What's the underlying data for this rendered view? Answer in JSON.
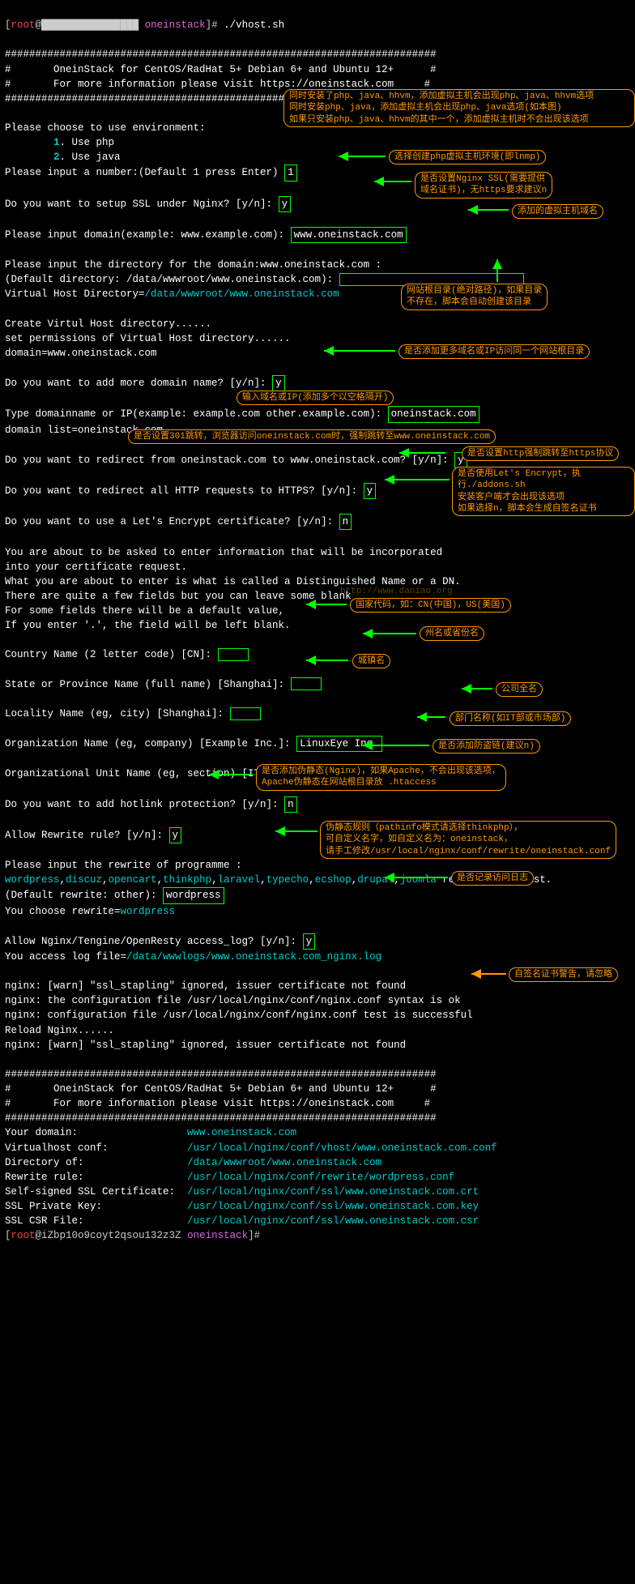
{
  "prompt1": {
    "user": "root",
    "host": "@",
    "hostblur": "████████████████",
    "dir": "oneinstack",
    "cmd": "./vhost.sh"
  },
  "banner": {
    "bar": "#######################################################################",
    "l1": "#       OneinStack for CentOS/RadHat 5+ Debian 6+ and Ubuntu 12+      #",
    "l2": "#       For more information please visit https://oneinstack.com     #"
  },
  "env": {
    "title": "Please choose to use environment:",
    "o1": "1",
    "o1t": ". Use php",
    "o2": "2",
    "o2t": ". Use java",
    "numq": "Please input a number:(Default 1 press Enter) ",
    "numv": "1"
  },
  "ssl": {
    "q": "Do you want to setup SSL under Nginx? [y/n]: ",
    "v": "y"
  },
  "domain": {
    "q": "Please input domain(example: www.example.com): ",
    "v": "www.oneinstack.com"
  },
  "dir": {
    "l1": "Please input the directory for the domain:www.oneinstack.com :",
    "l2": "(Default directory: /data/wwwroot/www.oneinstack.com): ",
    "l3a": "Virtual Host Directory=",
    "l3b": "/data/wwwroot/www.oneinstack.com"
  },
  "create": {
    "l1": "Create Virtul Host directory......",
    "l2": "set permissions of Virtual Host directory......",
    "l3": "domain=www.oneinstack.com"
  },
  "more": {
    "q": "Do you want to add more domain name? [y/n]: ",
    "v": "y"
  },
  "type": {
    "q": "Type domainname or IP(example: example.com other.example.com): ",
    "v": "oneinstack.com",
    "list": "domain list=oneinstack.com"
  },
  "redir1": {
    "q": "Do you want to redirect from oneinstack.com to www.oneinstack.com? [y/n]: ",
    "v": "y"
  },
  "redir2": {
    "q": "Do you want to redirect all HTTP requests to HTTPS? [y/n]: ",
    "v": "y"
  },
  "le": {
    "q": "Do you want to use a Let's Encrypt certificate? [y/n]: ",
    "v": "n"
  },
  "cert": {
    "l1": "You are about to be asked to enter information that will be incorporated",
    "l2": "into your certificate request.",
    "l3": "What you are about to enter is what is called a Distinguished Name or a DN.",
    "l4": "There are quite a few fields but you can leave some blank",
    "l5": "For some fields there will be a default value,",
    "l6": "If you enter '.', the field will be left blank."
  },
  "wm": "http://www.daniao.org",
  "csr": {
    "cn": "Country Name (2 letter code) [CN]: ",
    "sp": "State or Province Name (full name) [Shanghai]: ",
    "lc": "Locality Name (eg, city) [Shanghai]: ",
    "org": "Organization Name (eg, company) [Example Inc.]: ",
    "orgv": "LinuxEye Inc.",
    "ou": "Organizational Unit Name (eg, section) [IT Dept.]: "
  },
  "hot": {
    "q": "Do you want to add hotlink protection? [y/n]: ",
    "v": "n"
  },
  "rw": {
    "q": "Allow Rewrite rule? [y/n]: ",
    "v": "y"
  },
  "rwp": {
    "l1": "Please input the rewrite of programme :",
    "l2a": "wordpress",
    "l2b": ",",
    "l2c": "discuz",
    "l2d": "opencart",
    "l2e": "thinkphp",
    "l2f": "laravel",
    "l2g": "typecho",
    "l2h": "ecshop",
    "l2i": "drupal",
    "l2j": "joomla",
    "l2k": " rewrite was exist.",
    "l3": "(Default rewrite: other): ",
    "l3v": "wordpress",
    "l4": "You choose rewrite=",
    "l4v": "wordpress"
  },
  "log": {
    "q": "Allow Nginx/Tengine/OpenResty access_log? [y/n]: ",
    "v": "y",
    "l2": "You access log file=",
    "l2v": "/data/wwwlogs/www.oneinstack.com_nginx.log"
  },
  "ng": {
    "l1": "nginx: [warn] \"ssl_stapling\" ignored, issuer certificate not found",
    "l2": "nginx: the configuration file /usr/local/nginx/conf/nginx.conf syntax is ok",
    "l3": "nginx: configuration file /usr/local/nginx/conf/nginx.conf test is successful",
    "l4": "Reload Nginx......",
    "l5": "nginx: [warn] \"ssl_stapling\" ignored, issuer certificate not found"
  },
  "out": {
    "k1": "Your domain:",
    "v1": "www.oneinstack.com",
    "k2": "Virtualhost conf:",
    "v2": "/usr/local/nginx/conf/vhost/www.oneinstack.com.conf",
    "k3": "Directory of:",
    "v3": "/data/wwwroot/www.oneinstack.com",
    "k4": "Rewrite rule:",
    "v4": "/usr/local/nginx/conf/rewrite/wordpress.conf",
    "k5": "Self-signed SSL Certificate:",
    "v5": "/usr/local/nginx/conf/ssl/www.oneinstack.com.crt",
    "k6": "SSL Private Key:",
    "v6": "/usr/local/nginx/conf/ssl/www.oneinstack.com.key",
    "k7": "SSL CSR File:",
    "v7": "/usr/local/nginx/conf/ssl/www.oneinstack.com.csr"
  },
  "prompt2": {
    "user": "root",
    "host": "@iZbp10o9coyt2qsou132z3Z",
    "dir": "oneinstack"
  },
  "a": {
    "env": "同时安装了php、java、hhvm，添加虚拟主机会出现php、java、hhvm选项\n同时安装php、java，添加虚拟主机会出现php、java选项(如本图)\n如果只安装php、java、hhvm的其中一个，添加虚拟主机时不会出现该选项",
    "num": "选择创建php虚拟主机环境(即lnmp)",
    "ssl": "是否设置Nginx SSL(需要提供\n域名证书)，无https要求建议n",
    "domain": "添加的虚拟主机域名",
    "dir": "网站根目录(绝对路径)，如果目录\n不存在，脚本会自动创建该目录",
    "more": "是否添加更多域名或IP访问同一个网站根目录",
    "type": "输入域名或IP(添加多个以空格隔开)",
    "r301": "是否设置301跳转，浏览器访问oneinstack.com时，强制跳转至www.oneinstack.com",
    "https": "是否设置http强制跳转至https协议",
    "le": "是否使用Let's Encrypt，执行./addons.sh\n安装客户端才会出现该选项\n如果选择n，脚本会生成自签名证书",
    "cn": "国家代码，如：CN(中国)，US(美国)",
    "sp": "州名或省份名",
    "lc": "城镇名",
    "org": "公司全名",
    "ou": "部门名称(如IT部或市场部)",
    "hot": "是否添加防盗链(建议n)",
    "rw": "是否添加伪静态(Nginx)，如果Apache，不会出现该选项，\nApache伪静态在网站根目录放 .htaccess",
    "rwp": "伪静态规则（pathinfo模式请选择thinkphp），\n可自定义名字，如自定义名为：oneinstack，\n请手工修改/usr/local/nginx/conf/rewrite/oneinstack.conf",
    "log": "是否记录访问日志",
    "warn": "自签名证书警告，请忽略"
  }
}
